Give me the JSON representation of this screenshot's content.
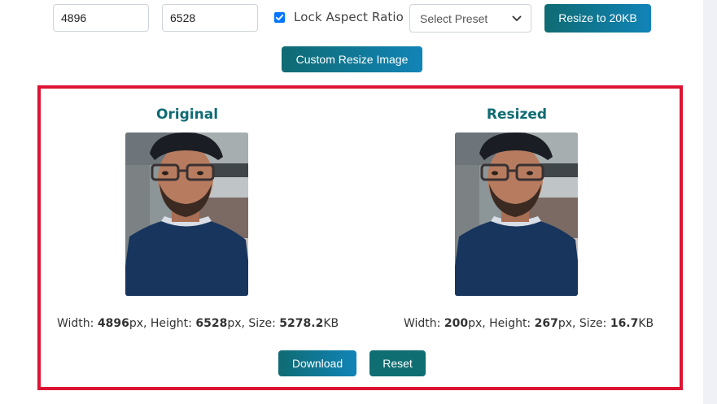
{
  "controls": {
    "width_value": "4896",
    "height_value": "6528",
    "lock_aspect_label": "Lock Aspect Ratio",
    "lock_aspect_checked": true,
    "preset_selected": "Select Preset",
    "resize_button_label": "Resize to 20KB",
    "custom_button_label": "Custom Resize Image"
  },
  "results": {
    "original": {
      "title": "Original",
      "width_label": "Width: ",
      "width": "4896",
      "height_label": "px, Height: ",
      "height": "6528",
      "size_label": "px, Size: ",
      "size": "5278.2",
      "size_unit": "KB"
    },
    "resized": {
      "title": "Resized",
      "width_label": "Width: ",
      "width": "200",
      "height_label": "px, Height: ",
      "height": "267",
      "size_label": "px, Size: ",
      "size": "16.7",
      "size_unit": "KB"
    },
    "download_label": "Download",
    "reset_label": "Reset"
  },
  "colors": {
    "frame_border": "#dc1332",
    "accent_teal": "#0f6b73",
    "accent_blue": "#1184b7",
    "checkbox": "#0075ff"
  },
  "icons": {
    "checkbox": "checkmark-icon",
    "select": "chevron-down-icon"
  }
}
